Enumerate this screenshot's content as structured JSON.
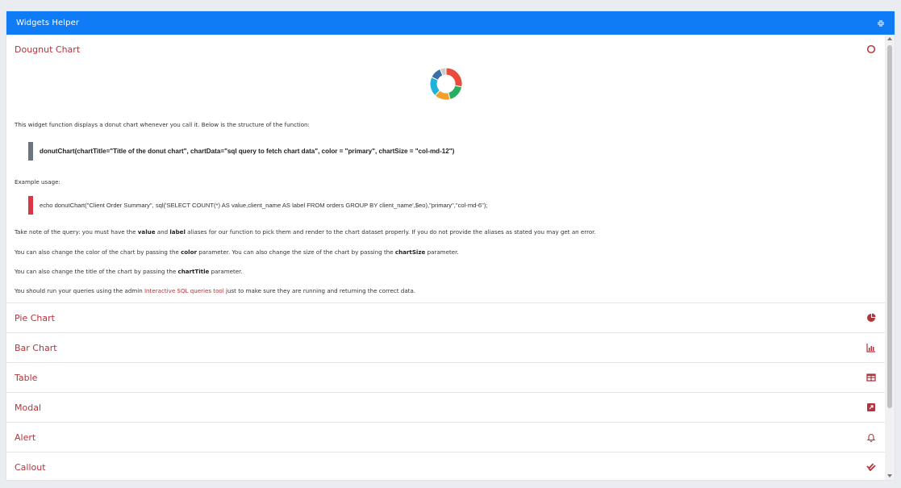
{
  "header": {
    "title": "Widgets Helper",
    "collapse_icon": "collapse-icon",
    "color": "#0f7bf5"
  },
  "sections": [
    {
      "title": "Dougnut Chart",
      "icon": "circle-outline-icon",
      "expanded": true
    },
    {
      "title": "Pie Chart",
      "icon": "pie-chart-icon"
    },
    {
      "title": "Bar Chart",
      "icon": "bar-chart-icon"
    },
    {
      "title": "Table",
      "icon": "table-icon"
    },
    {
      "title": "Modal",
      "icon": "external-window-icon"
    },
    {
      "title": "Alert",
      "icon": "bell-icon"
    },
    {
      "title": "Callout",
      "icon": "double-check-icon"
    }
  ],
  "doughnut": {
    "intro": "This widget function displays a donut chart whenever you call it. Below is the structure of the function:",
    "signature": "donutChart(chartTitle=\"Title of the donut chart\", chartData=\"sql query to fetch chart data\", color = \"primary\", chartSize = \"col-md-12\")",
    "example_label": "Example usage:",
    "example_code": "echo donutChart(\"Client Order Summary\", sql('SELECT COUNT(*) AS value,client_name AS label FROM orders GROUP BY client_name',$eo),\"primary\",\"col-md-6\");",
    "note_pre": "Take note of the query: you must have the ",
    "note_value": "value",
    "note_and": " and ",
    "note_label": "label",
    "note_post": " aliases for our function to pick them and render to the chart dataset properly. If you do not provide the aliases as stated you may get an error.",
    "color_pre": "You can also change the color of the chart by passing the ",
    "color_param": "color",
    "color_mid": " parameter. You can also change the size of the chart by passing the ",
    "size_param": "chartSize",
    "color_post": " parameter.",
    "title_pre": "You can also change the title of the chart by passing the ",
    "title_param": "chartTitle",
    "title_post": " parameter.",
    "run_pre": "You should run your queries using the admin ",
    "run_link": "Interactive SQL queries tool",
    "run_post": " just to make sure they are running and returning the correct data.",
    "donut_slices": [
      {
        "value": 28,
        "color": "#e74c3c"
      },
      {
        "value": 18,
        "color": "#27ae60"
      },
      {
        "value": 16,
        "color": "#f1a12b"
      },
      {
        "value": 20,
        "color": "#20b2d8"
      },
      {
        "value": 12,
        "color": "#3a6fa8"
      },
      {
        "value": 6,
        "color": "#c8ccd2"
      }
    ]
  },
  "colors": {
    "accent": "#b5333b",
    "code_bar_dark": "#6c757d",
    "code_bar_red": "#dc3545"
  }
}
